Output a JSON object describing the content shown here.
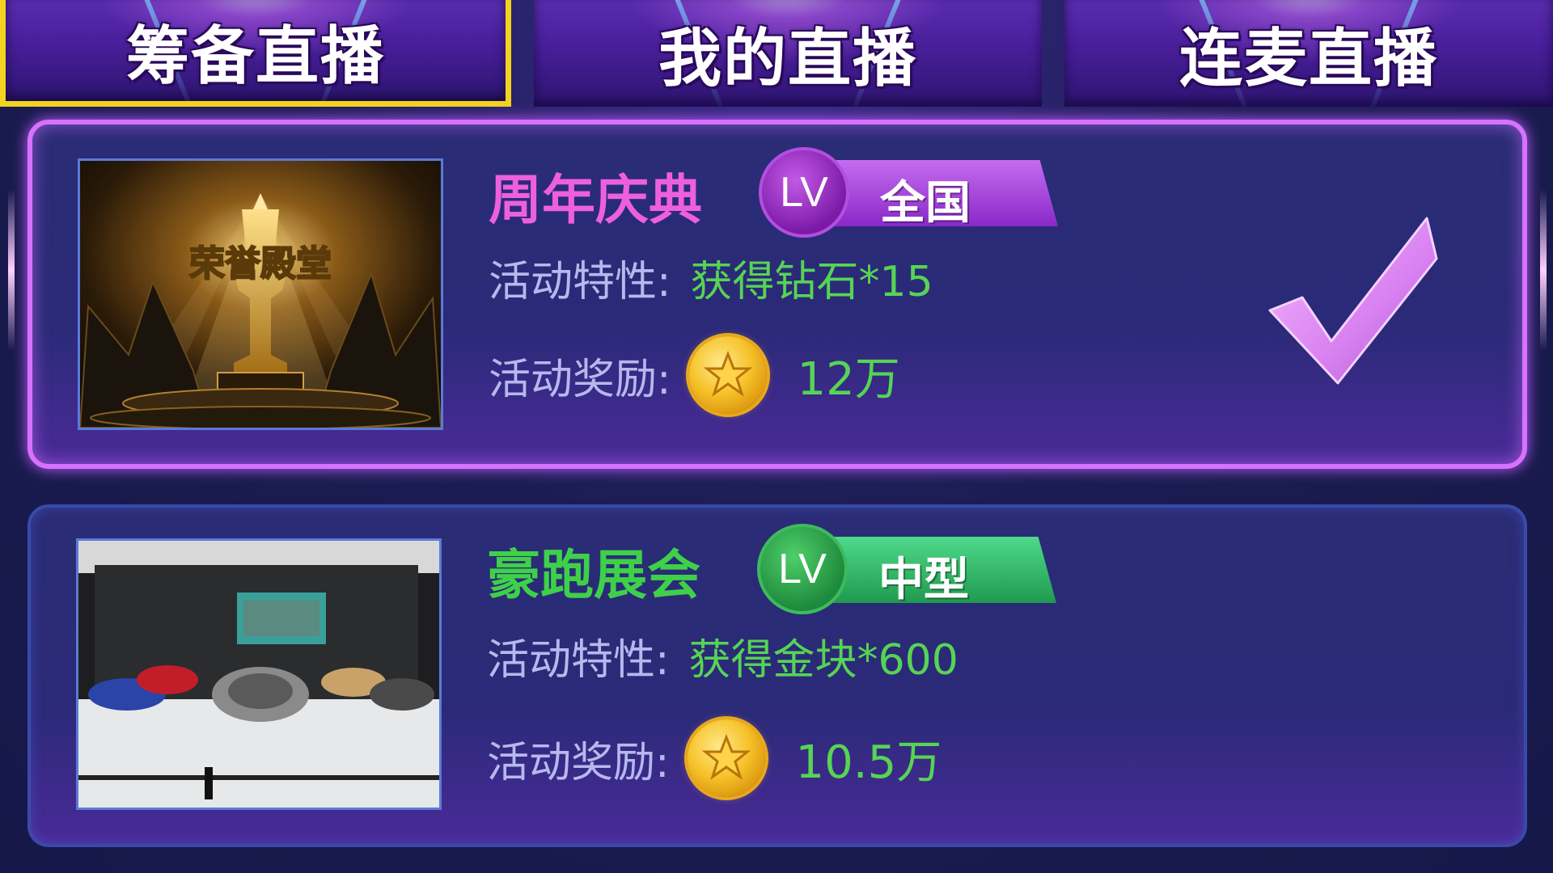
{
  "tabs": [
    {
      "label": "筹备直播",
      "active": true
    },
    {
      "label": "我的直播",
      "active": false
    },
    {
      "label": "连麦直播",
      "active": false
    }
  ],
  "events": [
    {
      "title": "周年庆典",
      "lv_text": "LV",
      "scope": "全国",
      "feature_label": "活动特性:",
      "feature_value": "获得钻石*15",
      "reward_label": "活动奖励:",
      "reward_value": "12万",
      "selected": true,
      "theme_color": "#ee5fe0"
    },
    {
      "title": "豪跑展会",
      "lv_text": "LV",
      "scope": "中型",
      "feature_label": "活动特性:",
      "feature_value": "获得金块*600",
      "reward_label": "活动奖励:",
      "reward_value": "10.5万",
      "selected": false,
      "theme_color": "#3fd04a"
    }
  ],
  "icons": {
    "coin": "gold-coin-star-icon",
    "check": "checkmark-icon"
  },
  "colors": {
    "active_tab_border": "#f2d320",
    "selected_card_border": "#d672ff",
    "value_green": "#56d454",
    "label_lavender": "#b6b8ee"
  }
}
